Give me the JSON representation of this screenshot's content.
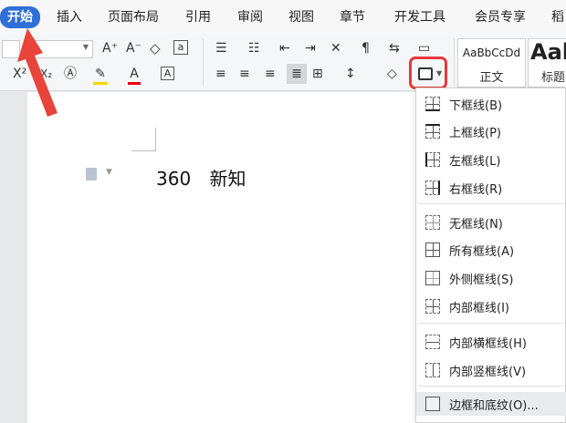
{
  "tabs": [
    "开始",
    "插入",
    "页面布局",
    "引用",
    "审阅",
    "视图",
    "章节",
    "开发工具",
    "会员专享",
    "稻"
  ],
  "ribbon": {
    "superscript": "X²",
    "subscript": "X₂",
    "grow_font": "A⁺",
    "shrink_font": "A⁻",
    "font_color": "A",
    "char_border": "A",
    "styles": [
      {
        "sample": "AaBbCcDd",
        "label": "正文"
      },
      {
        "sample": "Aal",
        "label": "标题"
      }
    ]
  },
  "document": {
    "number": "360",
    "text": "新知"
  },
  "border_menu": {
    "items": [
      {
        "label": "下框线(B)"
      },
      {
        "label": "上框线(P)"
      },
      {
        "label": "左框线(L)"
      },
      {
        "label": "右框线(R)"
      },
      {
        "label": "无框线(N)"
      },
      {
        "label": "所有框线(A)"
      },
      {
        "label": "外侧框线(S)"
      },
      {
        "label": "内部框线(I)"
      },
      {
        "label": "内部横框线(H)"
      },
      {
        "label": "内部竖框线(V)"
      },
      {
        "label": "边框和底纹(O)..."
      }
    ]
  },
  "colors": {
    "active_tab": "#2f6fd8",
    "highlight": "#e5393a",
    "text_highlight_bar": "#f5d800",
    "font_color_bar": "#e60012"
  },
  "icons": [
    "border-icon",
    "clear-format-icon",
    "bullet-list-icon",
    "numbered-list-icon",
    "align-left-icon",
    "align-center-icon",
    "align-right-icon",
    "justify-icon",
    "line-spacing-icon",
    "shading-icon"
  ]
}
